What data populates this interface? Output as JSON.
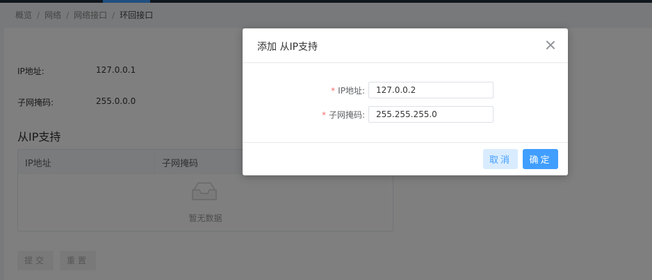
{
  "breadcrumb": {
    "items": [
      "概览",
      "网络",
      "网络接口",
      "环回接口"
    ],
    "separator": "/"
  },
  "info": {
    "ip_label": "IP地址:",
    "ip_value": "127.0.0.1",
    "mask_label": "子网掩码:",
    "mask_value": "255.0.0.0"
  },
  "section": {
    "title": "从IP支持"
  },
  "table": {
    "columns": [
      "IP地址",
      "子网掩码"
    ],
    "empty_text": "暂无数据"
  },
  "form_buttons": {
    "submit": "提交",
    "reset": "重置"
  },
  "dialog": {
    "title": "添加 从IP支持",
    "fields": [
      {
        "label": "IP地址:",
        "value": "127.0.0.2"
      },
      {
        "label": "子网掩码:",
        "value": "255.255.255.0"
      }
    ],
    "cancel_label": "取消",
    "ok_label": "确定"
  },
  "colors": {
    "primary": "#409eff",
    "required": "#f56c6c",
    "topbar": "#1f2d3d"
  },
  "icons": [
    "close-icon",
    "empty-box-icon"
  ]
}
